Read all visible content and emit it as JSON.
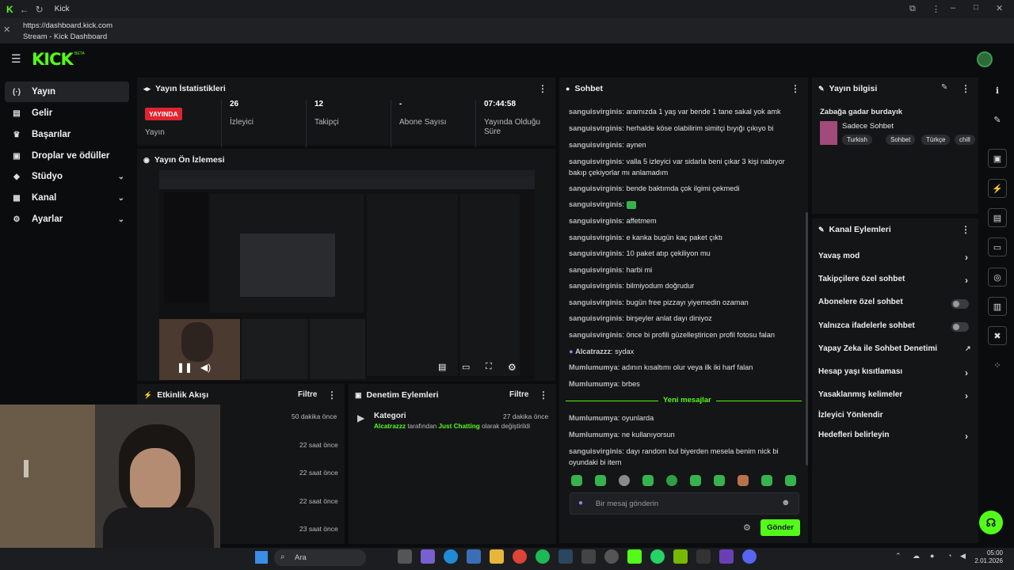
{
  "browser": {
    "tab_title": "Kick",
    "url": "https://dashboard.kick.com",
    "page_title": "Stream - Kick Dashboard"
  },
  "app": {
    "logo": "KICK",
    "logo_badge": "BETA",
    "accent": "#53fc18"
  },
  "sidebar": {
    "items": [
      {
        "label": "Yayın",
        "icon": "broadcast-icon",
        "glyph": "(·)",
        "expand": false
      },
      {
        "label": "Gelir",
        "icon": "revenue-icon",
        "glyph": "▤",
        "expand": false
      },
      {
        "label": "Başarılar",
        "icon": "trophy-icon",
        "glyph": "♛",
        "expand": false
      },
      {
        "label": "Droplar ve ödüller",
        "icon": "gift-icon",
        "glyph": "▣",
        "expand": false
      },
      {
        "label": "Stüdyo",
        "icon": "studio-icon",
        "glyph": "◆",
        "expand": true
      },
      {
        "label": "Kanal",
        "icon": "channel-icon",
        "glyph": "▦",
        "expand": true
      },
      {
        "label": "Ayarlar",
        "icon": "gear-icon",
        "glyph": "⚙",
        "expand": true
      }
    ]
  },
  "stats": {
    "title": "Yayın İstatistikleri",
    "live_badge": "YAYINDA",
    "live_label": "Yayın",
    "viewers_value": "26",
    "viewers_label": "İzleyici",
    "followers_value": "12",
    "followers_label": "Takipçi",
    "subs_value": "-",
    "subs_label": "Abone Sayısı",
    "uptime_value": "07:44:58",
    "uptime_label": "Yayında Olduğu Süre"
  },
  "preview": {
    "title": "Yayın Ön İzlemesi"
  },
  "activity": {
    "title": "Etkinlik Akışı",
    "filter": "Filtre",
    "rows": [
      "50 dakika önce",
      "22 saat önce",
      "22 saat önce",
      "22 saat önce",
      "23 saat önce"
    ]
  },
  "moderation": {
    "title": "Denetim Eylemleri",
    "filter": "Filtre",
    "item_title": "Kategori",
    "item_time": "27 dakika önce",
    "item_actor": "Alcatrazzz",
    "item_mid": "tarafından",
    "item_target": "Just Chatting",
    "item_end": "olarak değiştirildi"
  },
  "chat": {
    "title": "Sohbet",
    "new_messages": "Yeni mesajlar",
    "input_placeholder": "Bir mesaj gönderin",
    "send": "Gönder",
    "messages": [
      {
        "user": "sanguisvirginis",
        "text": "aramızda 1 yaş var bende 1 tane sakal yok amk"
      },
      {
        "user": "sanguisvirginis",
        "text": "herhalde köse olabilirim simitçi bıyığı çıkıyo bi"
      },
      {
        "user": "sanguisvirginis",
        "text": "aynen"
      },
      {
        "user": "sanguisvirginis",
        "text": "valla 5 izleyici var sidarla beni çıkar 3 kişi nabıyor bakıp çekiyorlar mı anlamadım"
      },
      {
        "user": "sanguisvirginis",
        "text": "bende baktımda çok ilgimi çekmedi"
      },
      {
        "user": "sanguisvirginis",
        "text": ""
      },
      {
        "user": "sanguisvirginis",
        "text": "affetmem"
      },
      {
        "user": "sanguisvirginis",
        "text": "e kanka bugün kaç paket çıktı"
      },
      {
        "user": "sanguisvirginis",
        "text": "10 paket atıp çekiliyon mu"
      },
      {
        "user": "sanguisvirginis",
        "text": "harbi mi"
      },
      {
        "user": "sanguisvirginis",
        "text": "bilmiyodum doğrudur"
      },
      {
        "user": "sanguisvirginis",
        "text": "bugün free pizzayı yiyemedin ozaman"
      },
      {
        "user": "sanguisvirginis",
        "text": "birşeyler anlat dayı diniyoz"
      },
      {
        "user": "sanguisvirginis",
        "text": "önce bi profili güzelleştiricen profil fotosu falan"
      },
      {
        "user": "Alcatrazzz",
        "text": "sydax"
      },
      {
        "user": "Mumlumumya",
        "text": "adının kısaltımı olur veya ilk iki harf falan"
      },
      {
        "user": "Mumlumumya",
        "text": "brbes"
      }
    ],
    "new_list": [
      {
        "user": "Mumlumumya",
        "text": "oyunlarda"
      },
      {
        "user": "Mumlumumya",
        "text": "ne kullanıyorsun"
      },
      {
        "user": "sanguisvirginis",
        "text": "dayı random bul biyerden mesela benim nick bi oyundaki bi item"
      }
    ]
  },
  "stream_info": {
    "title": "Yayın bilgisi",
    "stream_title": "Zabağa gadar burdayık",
    "category": "Sadece Sohbet",
    "tags": [
      "Turkish",
      "Sohbet",
      "Türkçe",
      "chill"
    ]
  },
  "channel_actions": {
    "title": "Kanal Eylemleri",
    "items": [
      {
        "label": "Yavaş mod",
        "type": "arrow"
      },
      {
        "label": "Takipçilere özel sohbet",
        "type": "arrow"
      },
      {
        "label": "Abonelere özel sohbet",
        "type": "toggle"
      },
      {
        "label": "Yalnızca ifadelerle sohbet",
        "type": "toggle"
      },
      {
        "label": "Yapay Zeka ile Sohbet Denetimi",
        "type": "external"
      },
      {
        "label": "Hesap yaşı kısıtlaması",
        "type": "arrow"
      },
      {
        "label": "Yasaklanmış kelimeler",
        "type": "arrow"
      },
      {
        "label": "İzleyici Yönlendir",
        "type": "none"
      },
      {
        "label": "Hedefleri belirleyin",
        "type": "arrow"
      }
    ]
  },
  "taskbar": {
    "search": "Ara",
    "time": "05:00",
    "date": "2.01.2026"
  }
}
